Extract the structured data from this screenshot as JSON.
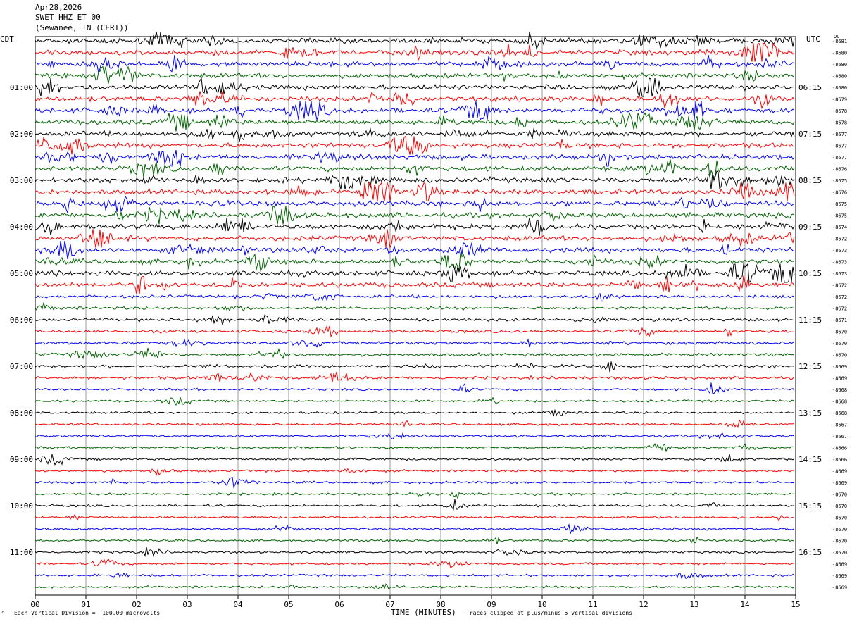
{
  "header": {
    "date": "Apr28,2026",
    "station": "SWET HHZ ET 00",
    "location": "(Sewanee, TN (CERI))"
  },
  "labels": {
    "left_tz": "CDT",
    "right_tz": "UTC",
    "dc_label": "DC",
    "scale_note": "Each Vertical Division =  100.00 microvolts",
    "xlabel": "TIME (MINUTES)",
    "clip_note": "Traces clipped at plus/minus 5 vertical divisions"
  },
  "chart_data": {
    "type": "line",
    "xlabel": "TIME (MINUTES)",
    "xlim": [
      0,
      15
    ],
    "x_ticks": [
      "00",
      "01",
      "02",
      "03",
      "04",
      "05",
      "06",
      "07",
      "08",
      "09",
      "10",
      "11",
      "12",
      "13",
      "14",
      "15"
    ],
    "trace_minutes": 15,
    "trace_count": 48,
    "trace_colors": [
      "#000000",
      "#ff0000",
      "#0000ff",
      "#006400"
    ],
    "left_hour_labels": [
      "01:00",
      "02:00",
      "03:00",
      "04:00",
      "05:00",
      "06:00",
      "07:00",
      "08:00",
      "09:00",
      "10:00",
      "11:00"
    ],
    "right_hour_labels": [
      "06:15",
      "07:15",
      "08:15",
      "09:15",
      "10:15",
      "11:15",
      "12:15",
      "13:15",
      "14:15",
      "15:15",
      "16:15"
    ],
    "dc_offsets": [
      "-8681",
      "-8680",
      "-8680",
      "-8680",
      "-8680",
      "-8679",
      "-8678",
      "-8678",
      "-8677",
      "-8677",
      "-8677",
      "-8676",
      "-8675",
      "-8676",
      "-8675",
      "-8675",
      "-8674",
      "-8672",
      "-8673",
      "-8673",
      "-8673",
      "-8672",
      "-8672",
      "-8672",
      "-8671",
      "-8670",
      "-8670",
      "-8670",
      "-8669",
      "-8669",
      "-8668",
      "-8668",
      "-8668",
      "-8667",
      "-8667",
      "-8666",
      "-8666",
      "-8669",
      "-8669",
      "-8670",
      "-8670",
      "-8670",
      "-8670",
      "-8670",
      "-8670",
      "-8669",
      "-8669",
      "-8669"
    ]
  }
}
